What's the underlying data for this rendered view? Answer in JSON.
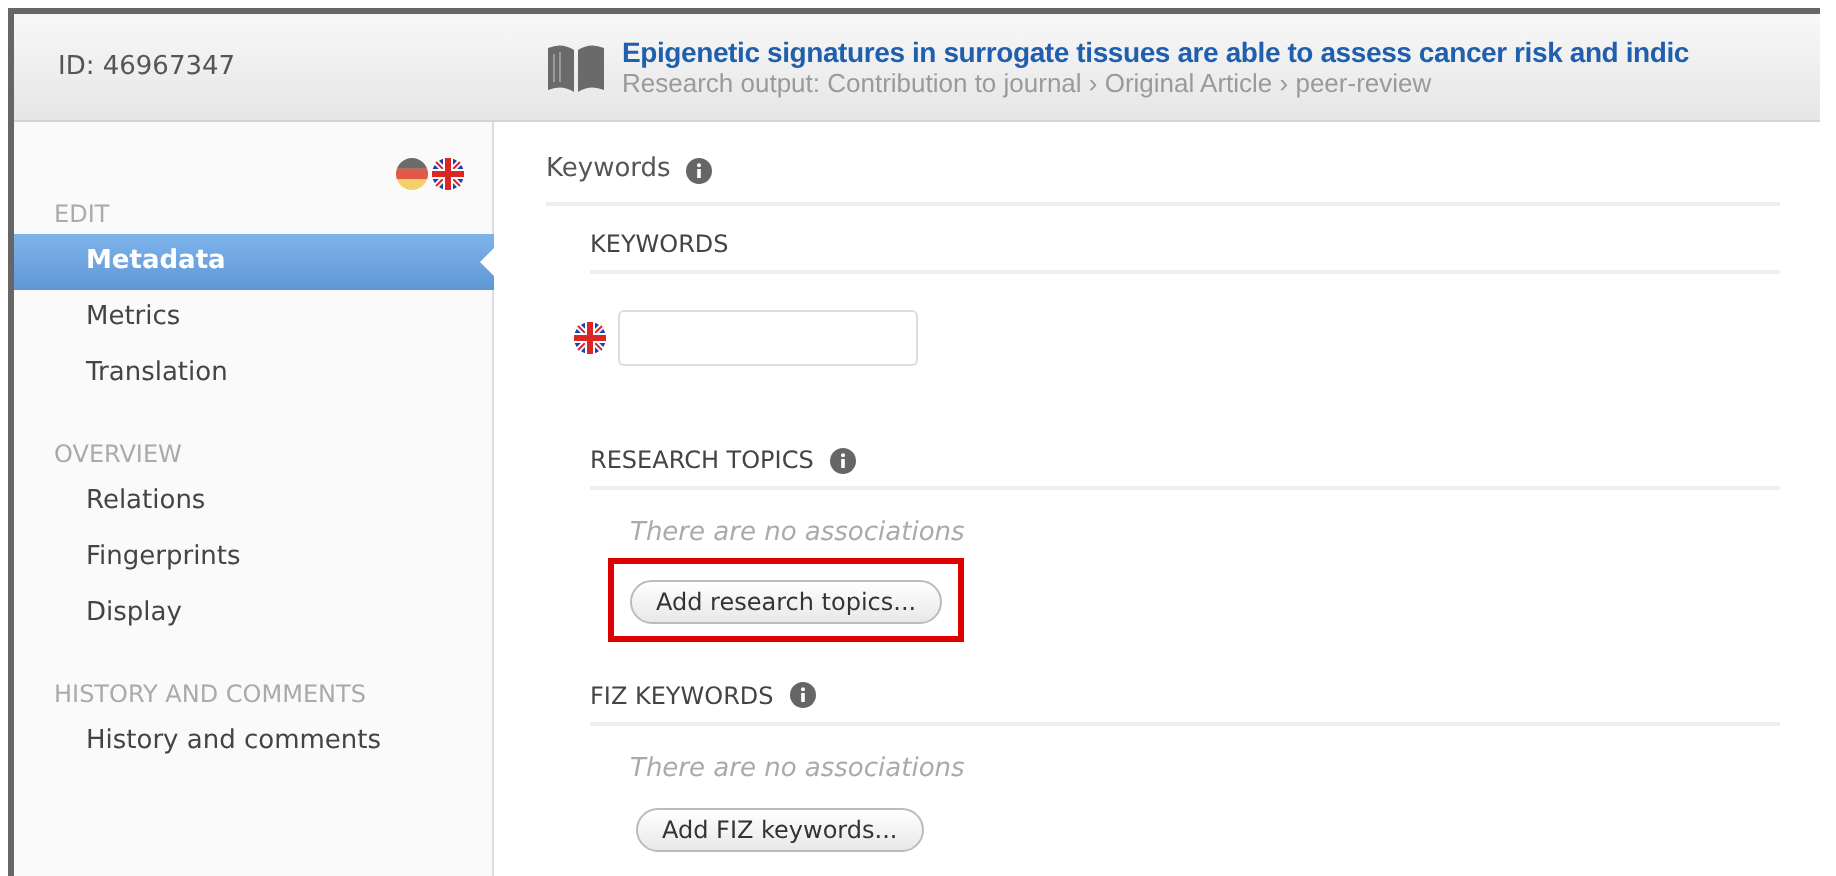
{
  "header": {
    "id": "ID: 46967347",
    "title": "Epigenetic signatures in surrogate tissues are able to assess cancer risk and indic",
    "subtitle": "Research output: Contribution to journal › Original Article › peer-review"
  },
  "languages": [
    {
      "kind": "de"
    },
    {
      "kind": "en"
    }
  ],
  "sidebar": {
    "groups": [
      {
        "heading": "EDIT",
        "items": [
          {
            "label": "Metadata",
            "selected": true
          },
          {
            "label": "Metrics",
            "selected": false
          },
          {
            "label": "Translation",
            "selected": false
          }
        ]
      },
      {
        "heading": "OVERVIEW",
        "items": [
          {
            "label": "Relations",
            "selected": false
          },
          {
            "label": "Fingerprints",
            "selected": false
          },
          {
            "label": "Display",
            "selected": false
          }
        ]
      },
      {
        "heading": "HISTORY AND COMMENTS",
        "items": [
          {
            "label": "History and comments",
            "selected": false
          }
        ]
      }
    ]
  },
  "main": {
    "heading": "Keywords",
    "sections": [
      {
        "kind": "input",
        "title": "KEYWORDS",
        "info": false
      },
      {
        "kind": "associations",
        "title": "RESEARCH TOPICS",
        "info": true,
        "empty_text": "There are no associations",
        "button": "Add research topics...",
        "highlighted": true
      },
      {
        "kind": "associations",
        "title": "FIZ KEYWORDS",
        "info": true,
        "empty_text": "There are no associations",
        "button": "Add FIZ keywords...",
        "highlighted": false
      }
    ]
  }
}
